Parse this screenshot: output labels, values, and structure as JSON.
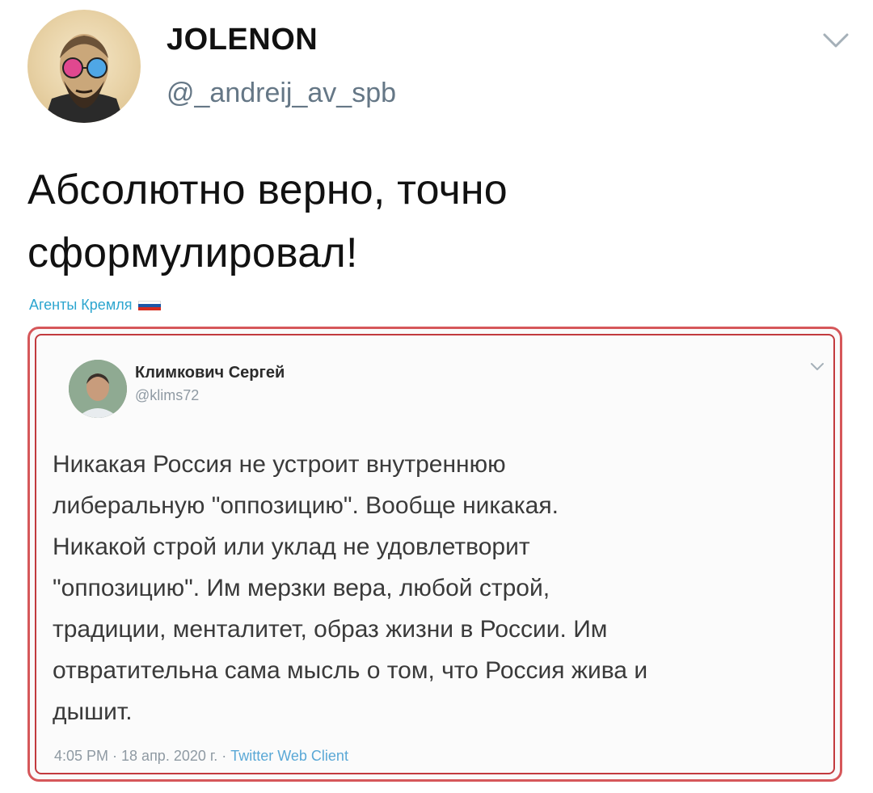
{
  "author": {
    "name": "JOLENON",
    "handle": "@_andreij_av_spb"
  },
  "tweet": {
    "text_line1": "Абсолютно верно, точно",
    "text_line2": "сформулировал!"
  },
  "source": {
    "label": "Агенты Кремля"
  },
  "quoted": {
    "name": "Климкович Сергей",
    "handle": "@klims72",
    "lines": [
      "Никакая Россия не устроит внутреннюю",
      "либеральную \"оппозицию\". Вообще никакая.",
      "Никакой строй или уклад не удовлетворит",
      "\"оппозицию\". Им мерзки вера, любой строй,",
      "традиции, менталитет, образ жизни в России. Им",
      "отвратительна сама мысль о том, что Россия жива и",
      "дышит."
    ],
    "time": "4:05 PM · 18 апр. 2020 г. · ",
    "client": "Twitter Web Client"
  },
  "colors": {
    "frame_red": "#c23a3e",
    "link_blue": "#2ca5cf",
    "handle_gray": "#657786"
  },
  "icons": {
    "menu": "chevron-down-icon",
    "flag": "russian-flag-icon"
  }
}
